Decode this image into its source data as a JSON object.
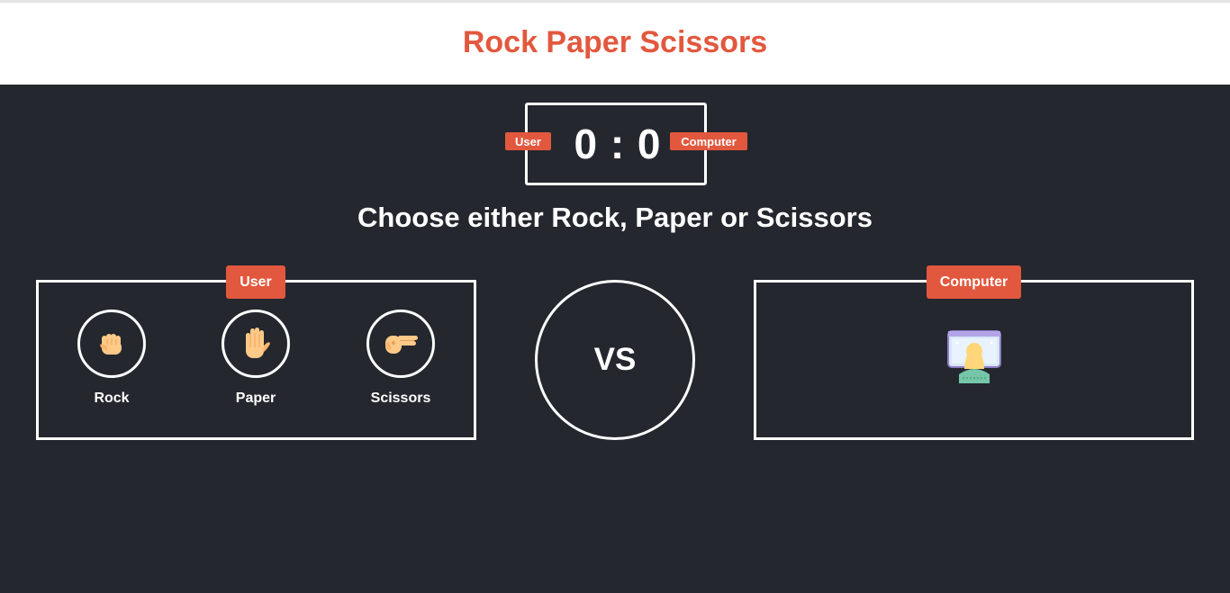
{
  "title": "Rock Paper Scissors",
  "score": {
    "user_label": "User",
    "computer_label": "Computer",
    "display": "0 : 0",
    "user": 0,
    "computer": 0
  },
  "prompt": "Choose either Rock, Paper or Scissors",
  "user_panel": {
    "badge": "User",
    "choices": [
      {
        "label": "Rock",
        "icon": "fist-hand-icon"
      },
      {
        "label": "Paper",
        "icon": "open-hand-icon"
      },
      {
        "label": "Scissors",
        "icon": "scissors-hand-icon"
      }
    ]
  },
  "vs_label": "VS",
  "computer_panel": {
    "badge": "Computer",
    "icon": "computer-user-icon"
  },
  "colors": {
    "accent": "#e2583e",
    "background": "#24272e",
    "header_bg": "#ffffff",
    "text_light": "#ffffff",
    "skin": "#ffc987"
  }
}
